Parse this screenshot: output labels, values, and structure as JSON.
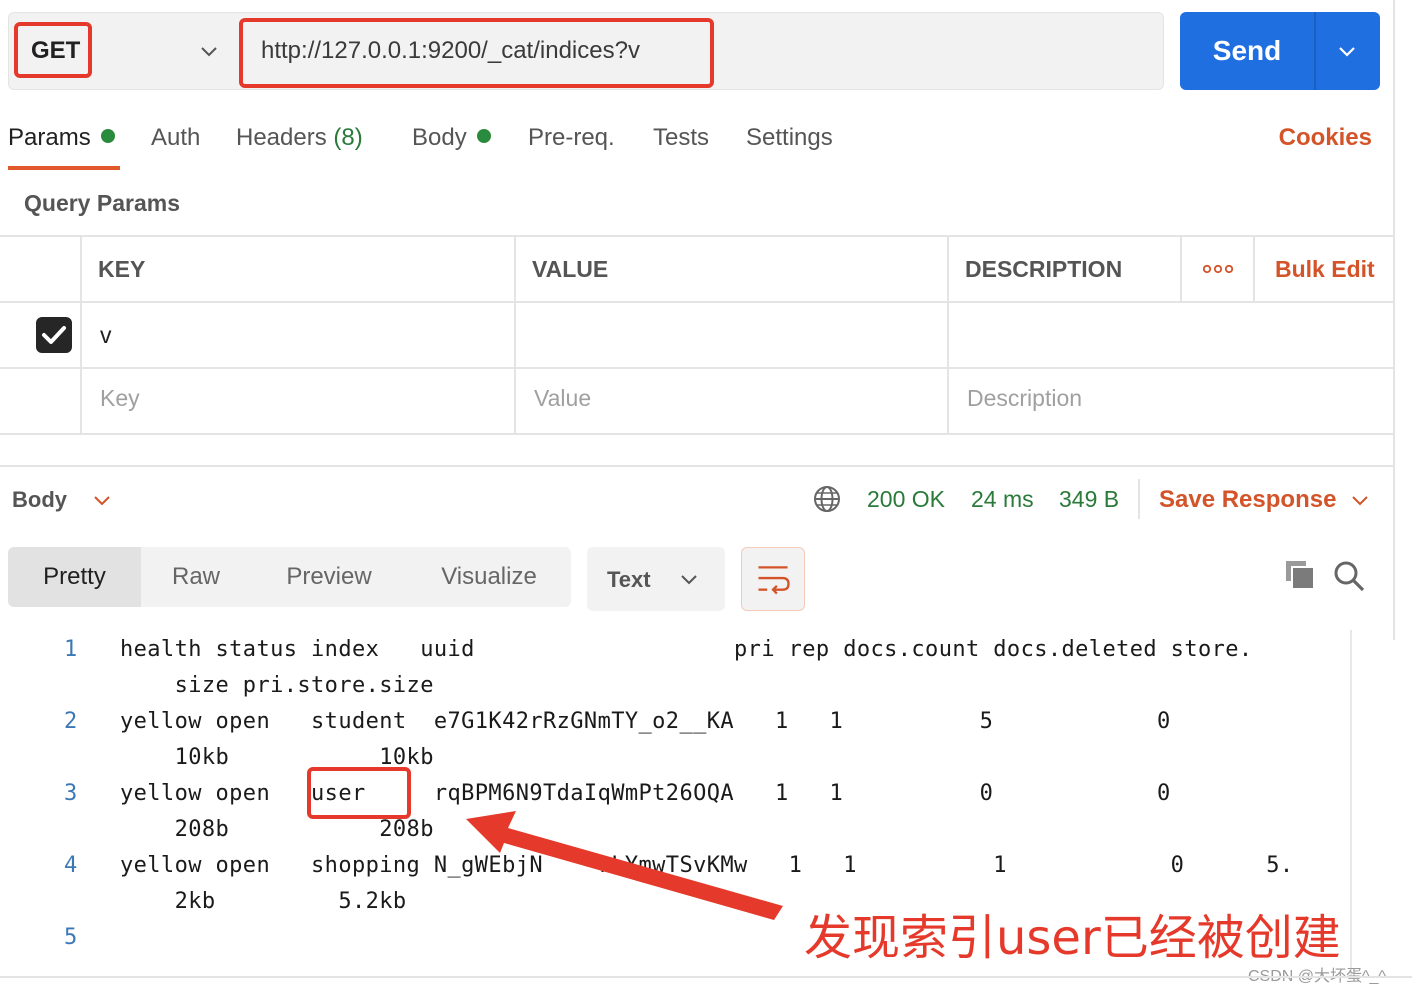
{
  "request": {
    "method": "GET",
    "url": "http://127.0.0.1:9200/_cat/indices?v",
    "send_label": "Send"
  },
  "tabs": [
    {
      "label": "Params"
    },
    {
      "label": "Auth"
    },
    {
      "label": "Headers",
      "count": "(8)"
    },
    {
      "label": "Body"
    },
    {
      "label": "Pre-req."
    },
    {
      "label": "Tests"
    },
    {
      "label": "Settings"
    }
  ],
  "cookies_label": "Cookies",
  "query_params": {
    "title": "Query Params",
    "columns": {
      "key": "KEY",
      "value": "VALUE",
      "description": "DESCRIPTION"
    },
    "bulk_edit": "Bulk Edit",
    "rows": [
      {
        "key": "v",
        "value": "",
        "description": "",
        "checked": true
      }
    ],
    "placeholder": {
      "key": "Key",
      "value": "Value",
      "description": "Description"
    }
  },
  "response": {
    "body_label": "Body",
    "status": "200 OK",
    "time": "24 ms",
    "size": "349 B",
    "save_label": "Save Response",
    "views": [
      "Pretty",
      "Raw",
      "Preview",
      "Visualize"
    ],
    "format": "Text",
    "line_numbers": [
      "1",
      "2",
      "3",
      "4",
      "5"
    ],
    "lines": [
      [
        "health status index   uuid                   pri rep docs.count docs.deleted store.",
        "    size pri.store.size"
      ],
      [
        "yellow open   student  e7G1K42rRzGNmTY_o2__KA   1   1          5            0       ",
        "    10kb           10kb"
      ],
      [
        "yellow open   user     rqBPM6N9TdaIqWmPt26OQA   1   1          0            0       ",
        "    208b           208b"
      ],
      [
        "yellow open   shopping N_gWEbjN    rLYmwTSvKMw   1   1          1            0      5.",
        "    2kb         5.2kb"
      ],
      [
        ""
      ]
    ]
  },
  "annotation": "发现索引user已经被创建",
  "watermark": "CSDN @大坏蛋^_^",
  "colors": {
    "accent": "#d4542a",
    "send": "#1f6fe0",
    "highlight": "#e53a2b",
    "status": "#2a7a3a"
  }
}
